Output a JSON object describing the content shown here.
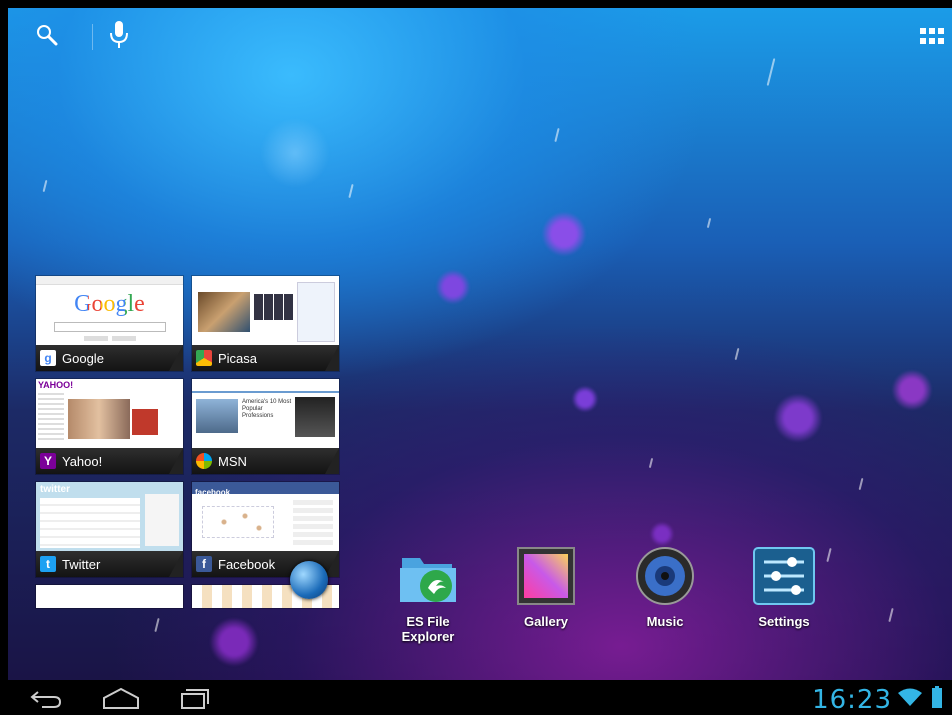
{
  "topbar": {
    "search_icon": "search-icon",
    "voice_icon": "microphone-icon",
    "apps_icon": "all-apps-grid-icon"
  },
  "recent_apps": [
    {
      "label": "Google",
      "icon": "google-icon",
      "color": "#4285f4"
    },
    {
      "label": "Picasa",
      "icon": "picasa-icon",
      "color": "#e8453c"
    },
    {
      "label": "Yahoo!",
      "icon": "yahoo-icon",
      "color": "#7b0099"
    },
    {
      "label": "MSN",
      "icon": "msn-icon",
      "color": "#00a4ef"
    },
    {
      "label": "Twitter",
      "icon": "twitter-icon",
      "color": "#1da1f2"
    },
    {
      "label": "Facebook",
      "icon": "facebook-icon",
      "color": "#3b5998"
    }
  ],
  "thumb_text": {
    "google_logo": "Google",
    "yahoo_logo": "YAHOO!",
    "msn_headline": "America's 10 Most Popular Professions",
    "facebook_logo": "facebook",
    "twitter_logo": "twitter"
  },
  "dock": [
    {
      "label": "ES File Explorer",
      "icon": "es-file-explorer-icon"
    },
    {
      "label": "Gallery",
      "icon": "gallery-icon"
    },
    {
      "label": "Music",
      "icon": "music-icon"
    },
    {
      "label": "Settings",
      "icon": "settings-icon"
    }
  ],
  "navbar": {
    "back_icon": "back-icon",
    "home_icon": "home-icon",
    "recents_icon": "recent-apps-icon"
  },
  "status": {
    "time": "16:23",
    "accent_color": "#33b5e5"
  }
}
